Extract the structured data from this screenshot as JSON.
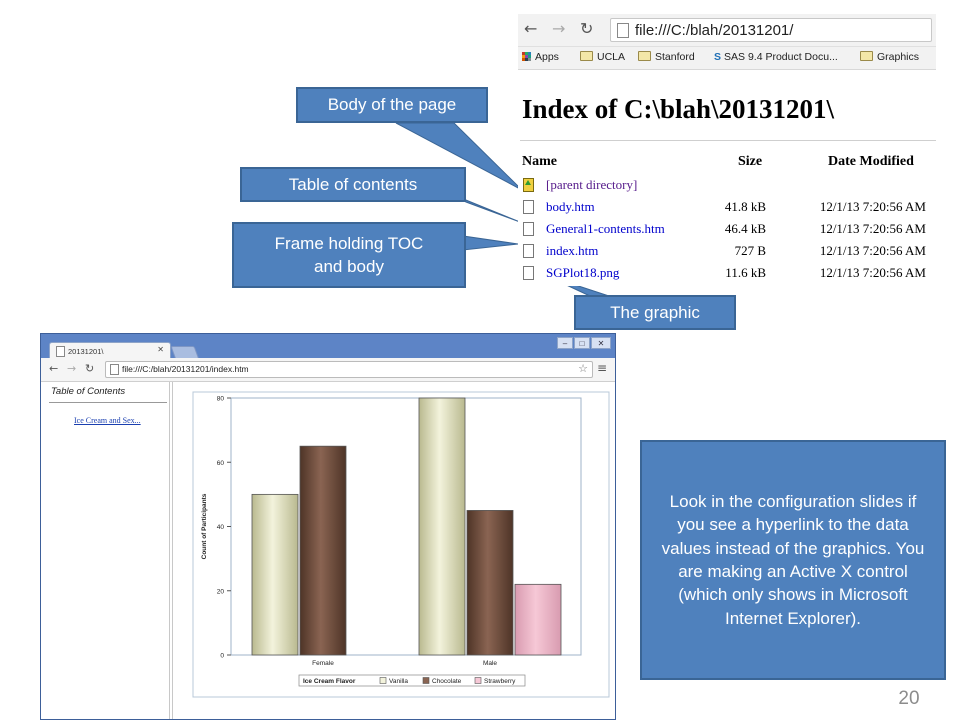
{
  "top_browser": {
    "url": "file:///C:/blah/20131201/",
    "bookmarks": [
      "Apps",
      "UCLA",
      "Stanford",
      "SAS 9.4 Product Docu...",
      "Graphics"
    ],
    "index_title": "Index of C:\\blah\\20131201\\",
    "columns": {
      "name": "Name",
      "size": "Size",
      "date": "Date Modified"
    },
    "parent_link": "[parent directory]",
    "files": [
      {
        "name": "body.htm",
        "size": "41.8 kB",
        "date": "12/1/13 7:20:56 AM"
      },
      {
        "name": "General1-contents.htm",
        "size": "46.4 kB",
        "date": "12/1/13 7:20:56 AM"
      },
      {
        "name": "index.htm",
        "size": "727 B",
        "date": "12/1/13 7:20:56 AM"
      },
      {
        "name": "SGPlot18.png",
        "size": "11.6 kB",
        "date": "12/1/13 7:20:56 AM"
      }
    ]
  },
  "callouts": {
    "body": "Body of the page",
    "toc": "Table of contents",
    "frame_line1": "Frame holding TOC",
    "frame_line2": "and body",
    "graphic": "The graphic",
    "note": "Look in the configuration slides if you see a hyperlink to the data values instead of the graphics.  You are making an Active X control (which only shows in Microsoft Internet Explorer)."
  },
  "bottom_browser": {
    "tab_title": "20131201\\",
    "url": "file:///C:/blah/20131201/index.htm",
    "toc_title": "Table of Contents",
    "toc_link": "Ice Cream and Sex..."
  },
  "chart_data": {
    "type": "bar",
    "categories": [
      "Female",
      "Male"
    ],
    "series": [
      {
        "name": "Vanilla",
        "values": [
          50,
          80
        ],
        "color": "#f3f3dc"
      },
      {
        "name": "Chocolate",
        "values": [
          65,
          45
        ],
        "color": "#8a6452"
      },
      {
        "name": "Strawberry",
        "values": [
          0,
          22
        ],
        "color": "#f6c8d6"
      }
    ],
    "ylabel": "Count of Participants",
    "ylim": [
      0,
      80
    ],
    "yticks": [
      0,
      20,
      40,
      60,
      80
    ],
    "legend_title": "Ice Cream Flavor",
    "legend_position": "bottom"
  },
  "slide_number": "20",
  "colors": {
    "callout": "#4f81bd",
    "callout_border": "#3a6595",
    "window_frame": "#5d84c6"
  }
}
